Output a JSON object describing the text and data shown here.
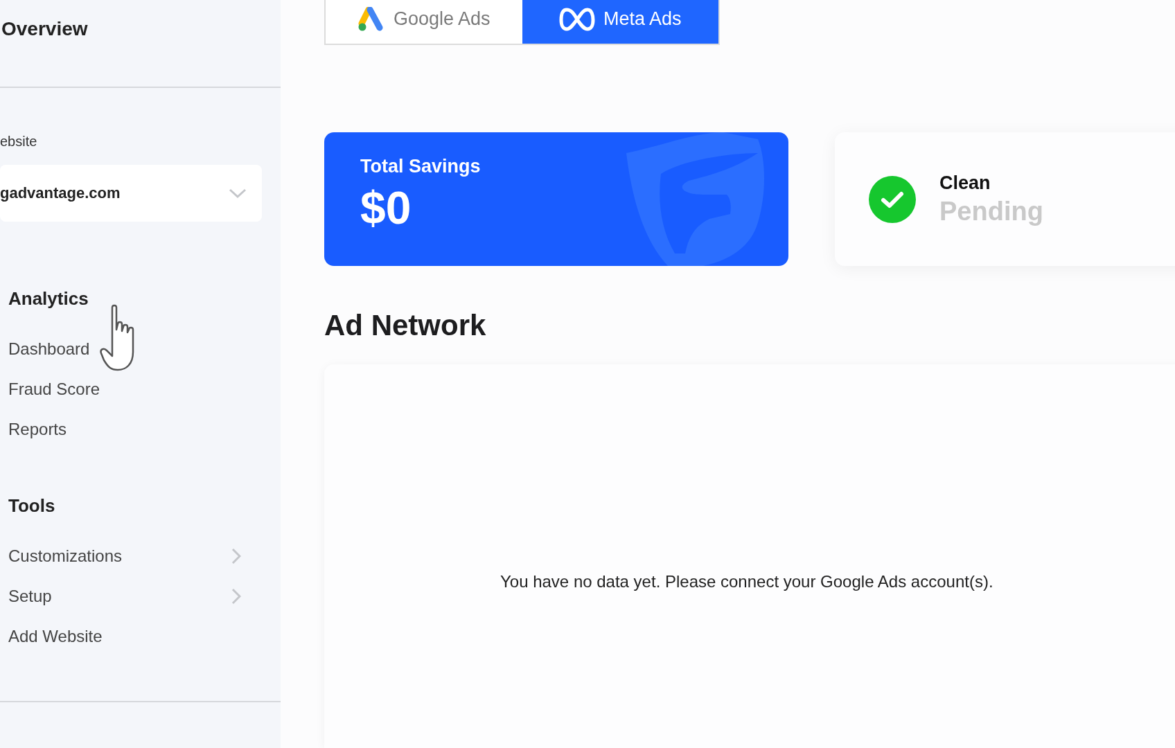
{
  "sidebar": {
    "title": "Overview",
    "website_label": "ebsite",
    "website_select": {
      "value": "gadvantage.com"
    },
    "sections": [
      {
        "title": "Analytics",
        "items": [
          {
            "label": "Dashboard",
            "has_submenu": false
          },
          {
            "label": "Fraud Score",
            "has_submenu": false
          },
          {
            "label": "Reports",
            "has_submenu": false
          }
        ]
      },
      {
        "title": "Tools",
        "items": [
          {
            "label": "Customizations",
            "has_submenu": true
          },
          {
            "label": "Setup",
            "has_submenu": true
          },
          {
            "label": "Add Website",
            "has_submenu": false
          }
        ]
      }
    ]
  },
  "network_tabs": [
    {
      "label": "Google Ads",
      "kind": "google",
      "selected": false
    },
    {
      "label": "Meta Ads",
      "kind": "meta",
      "selected": true
    }
  ],
  "savings_card": {
    "title": "Total Savings",
    "value": "$0"
  },
  "status_card": {
    "title": "Clean",
    "status": "Pending"
  },
  "ad_network": {
    "title": "Ad Network",
    "empty_message": "You have no data yet. Please connect your Google Ads account(s)."
  }
}
